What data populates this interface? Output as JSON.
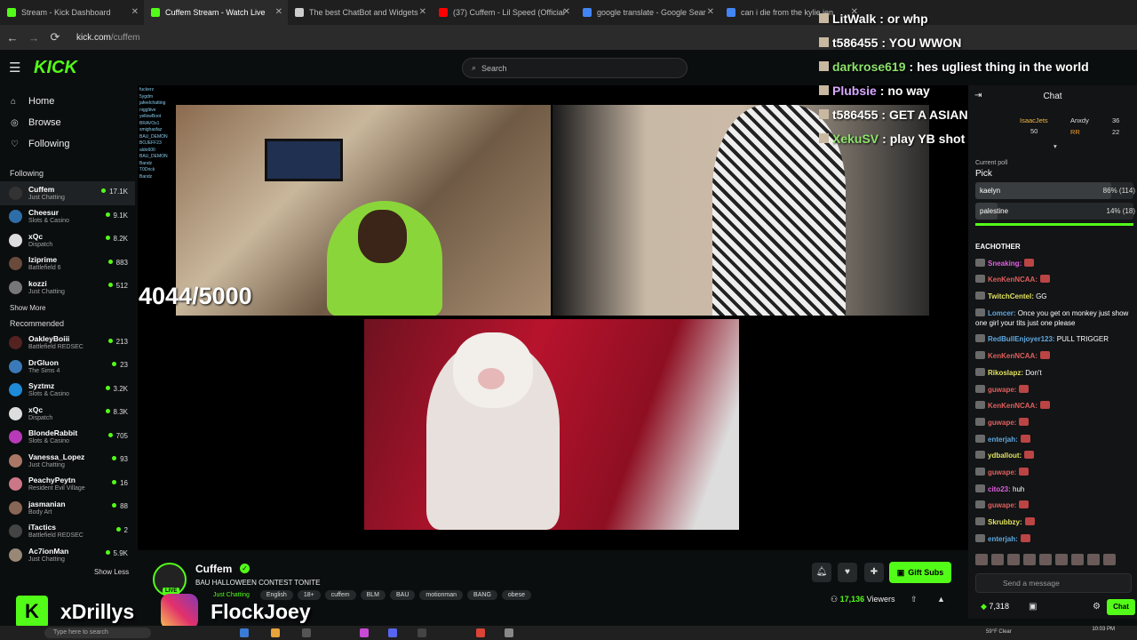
{
  "browser": {
    "tabs": [
      {
        "title": "Stream - Kick Dashboard",
        "favicon_color": "#53fc18",
        "active": false
      },
      {
        "title": "Cuffem Stream - Watch Live",
        "favicon_color": "#53fc18",
        "active": true
      },
      {
        "title": "The best ChatBot and Widgets",
        "favicon_color": "#cccccc",
        "active": false
      },
      {
        "title": "(37) Cuffem - Lil Speed (Official",
        "favicon_color": "#ff0000",
        "active": false
      },
      {
        "title": "google translate - Google Sear",
        "favicon_color": "#4285f4",
        "active": false
      },
      {
        "title": "can i die from the kylie jen",
        "favicon_color": "#4285f4",
        "active": false
      }
    ],
    "url_host": "kick.com",
    "url_path": "/cuffem"
  },
  "header": {
    "logo": "KICK",
    "search_placeholder": "Search"
  },
  "sidebar": {
    "nav": [
      {
        "label": "Home",
        "icon": "home-icon"
      },
      {
        "label": "Browse",
        "icon": "compass-icon"
      },
      {
        "label": "Following",
        "icon": "heart-icon"
      }
    ],
    "following_title": "Following",
    "following": [
      {
        "name": "Cuffem",
        "category": "Just Chatting",
        "viewers": "17.1K",
        "color": "#333333"
      },
      {
        "name": "Cheesur",
        "category": "Slots & Casino",
        "viewers": "9.1K",
        "color": "#2e6ea8"
      },
      {
        "name": "xQc",
        "category": "Dispatch",
        "viewers": "8.2K",
        "color": "#dddddd"
      },
      {
        "name": "lziprime",
        "category": "Battlefield 6",
        "viewers": "883",
        "color": "#6a4a3a"
      },
      {
        "name": "kozzi",
        "category": "Just Chatting",
        "viewers": "512",
        "color": "#777777"
      }
    ],
    "show_more": "Show More",
    "recommended_title": "Recommended",
    "recommended": [
      {
        "name": "OakleyBoiii",
        "category": "Battlefield REDSEC",
        "viewers": "213",
        "color": "#552222"
      },
      {
        "name": "DrGluon",
        "category": "The Sims 4",
        "viewers": "23",
        "color": "#3a7ab8"
      },
      {
        "name": "Syztmz",
        "category": "Slots & Casino",
        "viewers": "3.2K",
        "color": "#1f8ad8"
      },
      {
        "name": "xQc",
        "category": "Dispatch",
        "viewers": "8.3K",
        "color": "#dddddd"
      },
      {
        "name": "BlondeRabbit",
        "category": "Slots & Casino",
        "viewers": "705",
        "color": "#b83ab8"
      },
      {
        "name": "Vanessa_Lopez",
        "category": "Just Chatting",
        "viewers": "93",
        "color": "#aa7766"
      },
      {
        "name": "PeachyPeytn",
        "category": "Resident Evil Village",
        "viewers": "16",
        "color": "#cc7788"
      },
      {
        "name": "jasmanian",
        "category": "Body Art",
        "viewers": "88",
        "color": "#886655"
      },
      {
        "name": "iTactics",
        "category": "Battlefield REDSEC",
        "viewers": "2",
        "color": "#444444"
      },
      {
        "name": "Ac7ionMan",
        "category": "Just Chatting",
        "viewers": "5.9K",
        "color": "#998877"
      }
    ],
    "show_less": "Show Less"
  },
  "stream": {
    "counter_overlay": "4044/5000",
    "mini_chat_lines": [
      "fuckerz",
      "5ygdm",
      "jafeelchatting",
      "niggltive",
      "yellowBoot",
      "BRAVOx1",
      "smighasfaz",
      "BAU_DEMON",
      "BOJEFF23",
      "aldo600",
      "BAU_DEMON",
      "Bandz",
      "T0Drick",
      "Bandz"
    ]
  },
  "overlay_chat": [
    {
      "user": "LitWalk",
      "message": ": or whp",
      "color": "#ffffff"
    },
    {
      "user": "t586455",
      "message": ": YOU WWON",
      "color": "#ffffff"
    },
    {
      "user": "darkrose619",
      "message": ": hes ugliest thing in the world",
      "color": "#8de26b"
    },
    {
      "user": "Plubsie",
      "message": ": no way",
      "color": "#d7a8ff"
    },
    {
      "user": "t586455",
      "message": ": GET A ASIAN BABY DOLL",
      "color": "#ffffff"
    },
    {
      "user": "XekuSV",
      "message": ": play YB shot callin",
      "color": "#8de26b"
    }
  ],
  "streamer": {
    "name": "Cuffem",
    "title": "BAU HALLOWEEN CONTEST TONITE",
    "tags": [
      "Just Chatting",
      "English",
      "18+",
      "cuffem",
      "BLM",
      "BAU",
      "motionman",
      "BANG",
      "obese"
    ],
    "live_label": "LIVE",
    "gift_label": "Gift Subs",
    "viewers_value": "17,136",
    "viewers_label": "Viewers"
  },
  "chat": {
    "title": "Chat",
    "leaderboard": [
      {
        "name": "IsaacJets",
        "value": "50"
      },
      {
        "name": "Anxdy",
        "value": "36"
      },
      {
        "name": "RR",
        "value": "22"
      }
    ],
    "poll_label": "Current poll",
    "poll_question": "Pick",
    "poll_options": [
      {
        "label": "kaelyn",
        "pct_text": "86% (114)",
        "fraction": 0.86
      },
      {
        "label": "palestine",
        "pct_text": "14% (18)",
        "fraction": 0.14
      }
    ],
    "messages": [
      {
        "user": "EACHOTHER",
        "text": "",
        "color": "#ffffff"
      },
      {
        "user": "Sneaking:",
        "text": "",
        "color": "#e15fe1"
      },
      {
        "user": "KenKenNCAA:",
        "text": "",
        "color": "#e15f5f"
      },
      {
        "user": "TwitchCentel:",
        "text": " GG",
        "color": "#e1e15f"
      },
      {
        "user": "Lomcer:",
        "text": " Once you get on monkey just show one girl your tits just one please",
        "color": "#5fa8e1"
      },
      {
        "user": "RedBullEnjoyer123:",
        "text": " PULL TRIGGER",
        "color": "#5fa8e1"
      },
      {
        "user": "KenKenNCAA:",
        "text": "",
        "color": "#e15f5f"
      },
      {
        "user": "Rikoslapz:",
        "text": " Don't",
        "color": "#e1e15f"
      },
      {
        "user": "guwape:",
        "text": "",
        "color": "#e15f5f"
      },
      {
        "user": "KenKenNCAA:",
        "text": "",
        "color": "#e15f5f"
      },
      {
        "user": "guwape:",
        "text": "",
        "color": "#e15f5f"
      },
      {
        "user": "enterjah:",
        "text": "",
        "color": "#5fa8e1"
      },
      {
        "user": "ydballout:",
        "text": "",
        "color": "#e1e15f"
      },
      {
        "user": "guwape:",
        "text": "",
        "color": "#e15f5f"
      },
      {
        "user": "cito23:",
        "text": " huh",
        "color": "#e15fe1"
      },
      {
        "user": "guwape:",
        "text": "",
        "color": "#e15f5f"
      },
      {
        "user": "Skrubbzy:",
        "text": "",
        "color": "#e1e15f"
      },
      {
        "user": "enterjah:",
        "text": "",
        "color": "#5fa8e1"
      }
    ],
    "input_placeholder": "Send a message",
    "points": "7,318",
    "chat_button": "Chat"
  },
  "socials": {
    "kick_logo": "K",
    "kick_name": "xDrillys",
    "ig_name": "FlockJoey"
  },
  "taskbar": {
    "search_placeholder": "Type here to search",
    "weather": "59°F  Clear",
    "time": "10:03 PM"
  },
  "colors": {
    "accent": "#53fc18",
    "background": "#0b0e0f",
    "panel": "#121415"
  }
}
